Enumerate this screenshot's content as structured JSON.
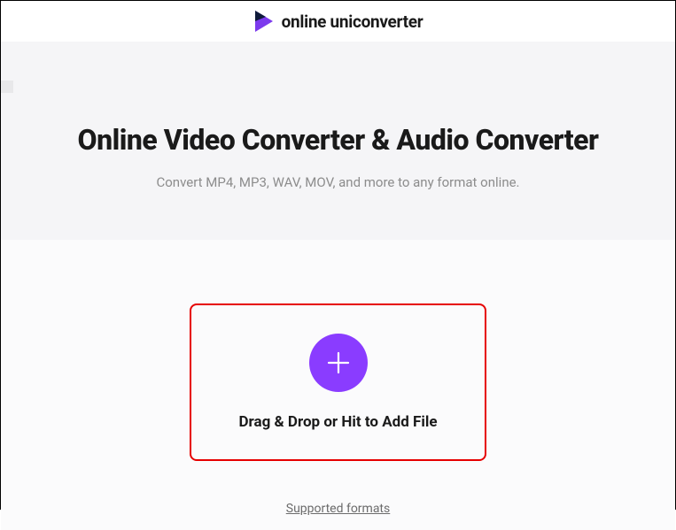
{
  "header": {
    "brand_name": "online uniconverter"
  },
  "hero": {
    "title": "Online Video Converter & Audio Converter",
    "subtitle": "Convert MP4, MP3, WAV, MOV, and more to any format online."
  },
  "upload": {
    "dropzone_label": "Drag & Drop or Hit to Add File",
    "plus_icon_name": "plus-icon",
    "supported_link_label": "Supported formats"
  },
  "colors": {
    "accent_purple": "#8a3cff",
    "highlight_border": "#e60000"
  }
}
